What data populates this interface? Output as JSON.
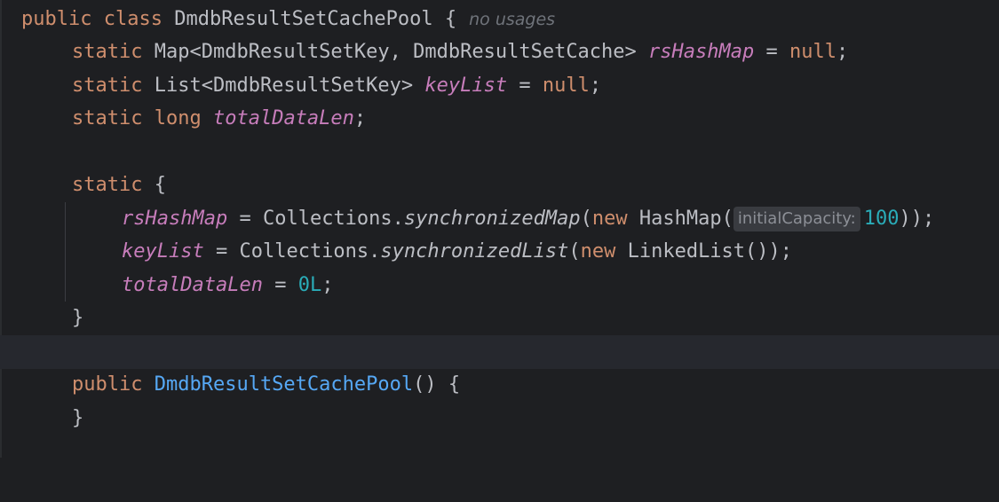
{
  "hints": {
    "usages": "no usages",
    "initial_capacity": "initialCapacity:"
  },
  "code": {
    "l1": {
      "kw_public": "public",
      "kw_class": "class",
      "class_name": "DmdbResultSetCachePool",
      "brace": "{"
    },
    "l2": {
      "kw": "static",
      "type": "Map<DmdbResultSetKey, DmdbResultSetCache>",
      "field": "rsHashMap",
      "eq": "=",
      "val": "null",
      "end": ";"
    },
    "l3": {
      "kw": "static",
      "type": "List<DmdbResultSetKey>",
      "field": "keyList",
      "eq": "=",
      "val": "null",
      "end": ";"
    },
    "l4": {
      "kw_static": "static",
      "kw_long": "long",
      "field": "totalDataLen",
      "end": ";"
    },
    "l6": {
      "kw": "static",
      "brace": "{"
    },
    "l7": {
      "field": "rsHashMap",
      "eq": "=",
      "recv": "Collections.",
      "method": "synchronizedMap",
      "open": "(",
      "kw_new": "new",
      "ctor": "HashMap(",
      "num": "100",
      "close": "));"
    },
    "l8": {
      "field": "keyList",
      "eq": "=",
      "recv": "Collections.",
      "method": "synchronizedList",
      "open": "(",
      "kw_new": "new",
      "ctor": "LinkedList());"
    },
    "l9": {
      "field": "totalDataLen",
      "eq": "=",
      "num": "0L",
      "end": ";"
    },
    "l10": {
      "brace": "}"
    },
    "l12": {
      "kw": "public",
      "ctor_name": "DmdbResultSetCachePool",
      "rest": "() {"
    },
    "l13": {
      "brace": "}"
    }
  }
}
